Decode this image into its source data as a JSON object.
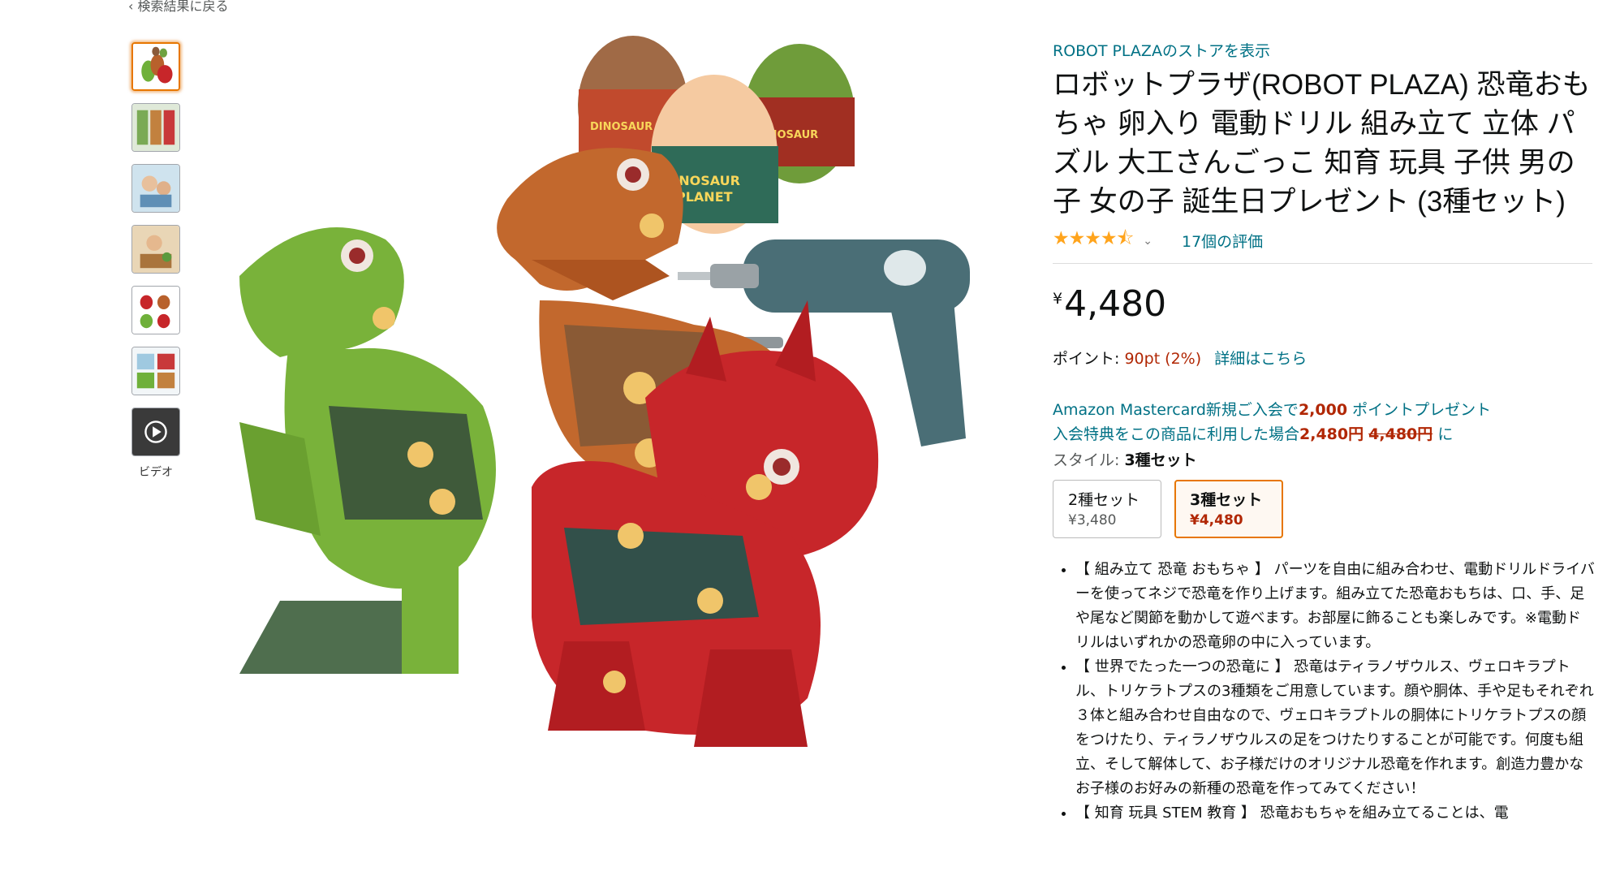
{
  "nav": {
    "back": "‹ 検索結果に戻る"
  },
  "thumbnails": {
    "video_label": "ビデオ"
  },
  "product": {
    "store_link": "ROBOT PLAZAのストアを表示",
    "title": "ロボットプラザ(ROBOT PLAZA) 恐竜おもちゃ 卵入り 電動ドリル 組み立て 立体 パズル 大工さんごっこ 知育 玩具 子供 男の子 女の子 誕生日プレゼント (3種セット)",
    "stars": "★★★★⯪",
    "rating_count": "17個の評価",
    "price_symbol": "¥",
    "price": "4,480",
    "points_label": "ポイント: ",
    "points_value": "90pt (2%)",
    "points_detail": "詳細はこちら",
    "promo1_prefix": "Amazon Mastercard新規ご入会で",
    "promo1_amount": "2,000",
    "promo1_suffix": " ポイントプレゼント",
    "promo2_prefix": "入会特典をこの商品に利用した場合",
    "promo2_price": "2,480円",
    "promo2_old": "4,480円",
    "promo2_suffix": "に",
    "style_label": "スタイル: ",
    "style_value": "3種セット",
    "swatches": [
      {
        "name": "2種セット",
        "price": "¥3,480"
      },
      {
        "name": "3種セット",
        "price": "¥4,480"
      }
    ],
    "bullets": [
      "【 組み立て 恐竜 おもちゃ 】 パーツを自由に組み合わせ、電動ドリルドライバーを使ってネジで恐竜を作り上げます。組み立てた恐竜おもちは、口、手、足や尾など関節を動かして遊べます。お部屋に飾ることも楽しみです。※電動ドリルはいずれかの恐竜卵の中に入っています。",
      "【 世界でたった一つの恐竜に 】 恐竜はティラノザウルス、ヴェロキラプトル、トリケラトプスの3種類をご用意しています。顔や胴体、手や足もそれぞれ３体と組み合わせ自由なので、ヴェロキラプトルの胴体にトリケラトプスの顔をつけたり、ティラノザウルスの足をつけたりすることが可能です。何度も組立、そして解体して、お子様だけのオリジナル恐竜を作れます。創造力豊かなお子様のお好みの新種の恐竜を作ってみてください！",
      "【 知育 玩具 STEM 教育 】 恐竜おもちゃを組み立てることは、電"
    ]
  },
  "colors": {
    "link": "#007185",
    "price_red": "#b12704",
    "star": "#ffa41c",
    "accent": "#e77600"
  }
}
